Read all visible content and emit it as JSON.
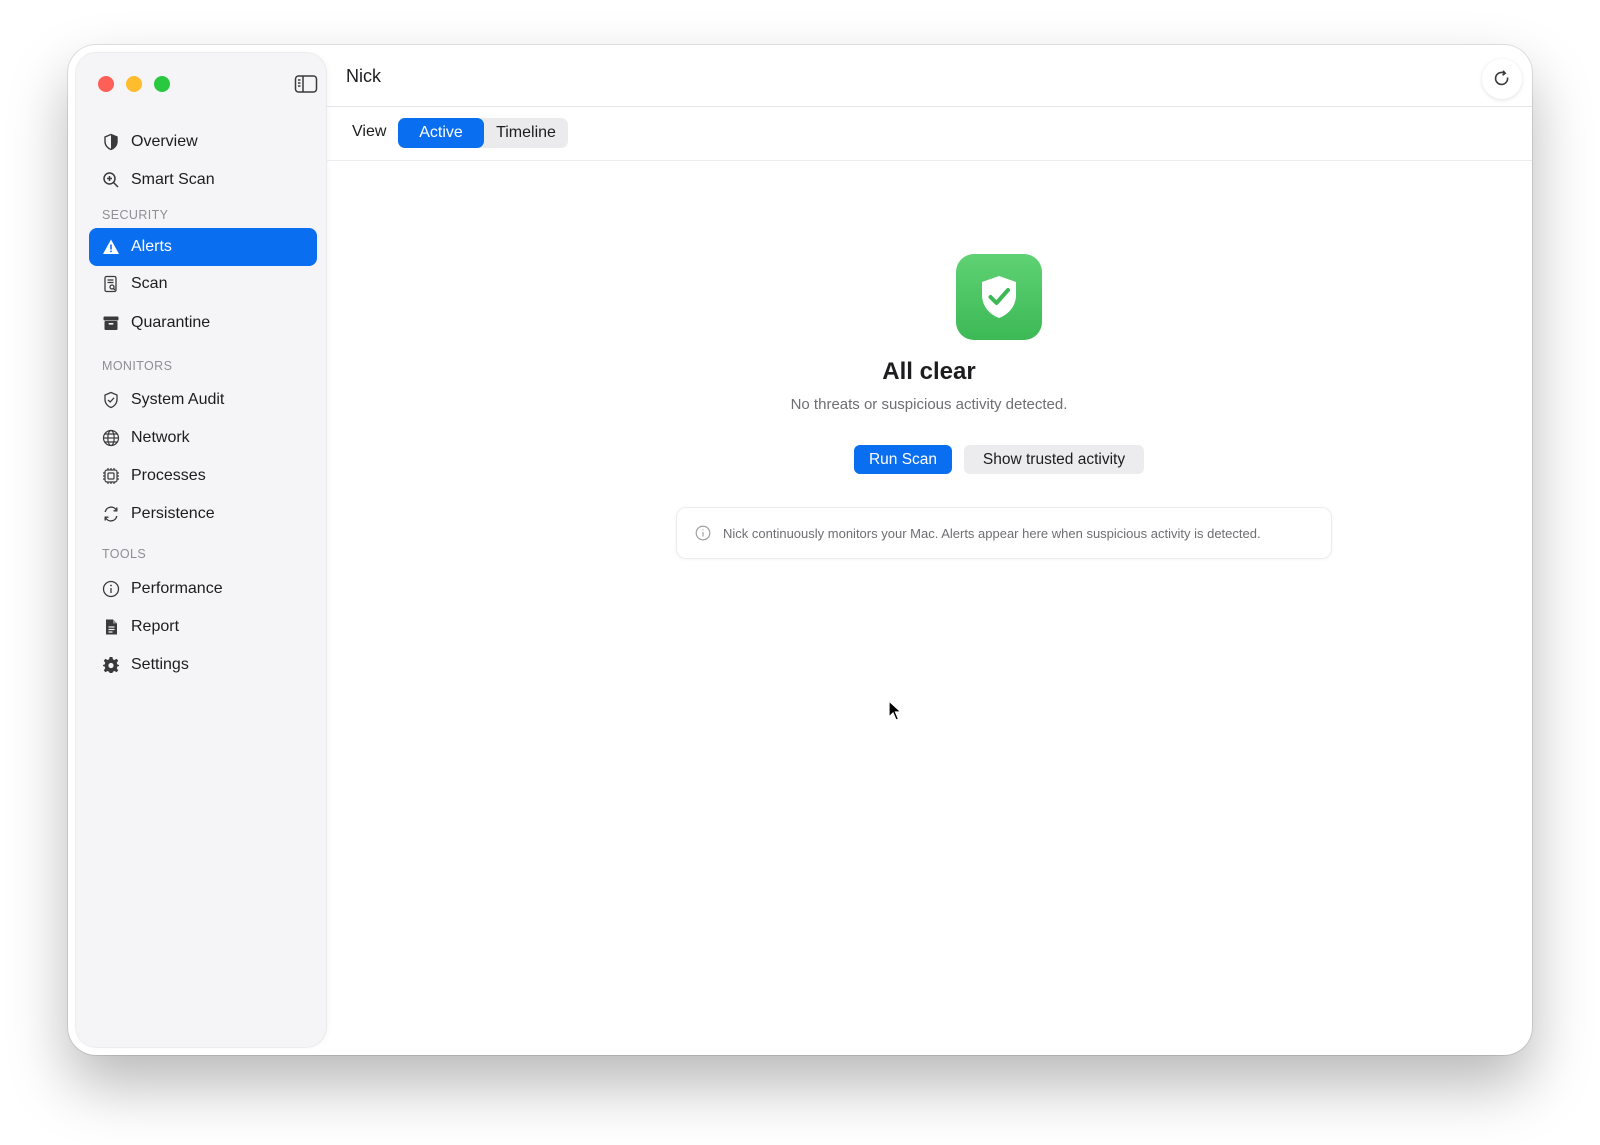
{
  "app": {
    "title": "Nick"
  },
  "sidebar": {
    "top_items": [
      {
        "label": "Overview",
        "icon": "shield-half-icon"
      },
      {
        "label": "Smart Scan",
        "icon": "magnifier-plus-icon"
      }
    ],
    "sections": [
      {
        "label": "SECURITY",
        "items": [
          {
            "label": "Alerts",
            "icon": "warning-triangle-icon",
            "active": true
          },
          {
            "label": "Scan",
            "icon": "document-search-icon"
          },
          {
            "label": "Quarantine",
            "icon": "archive-box-icon"
          }
        ]
      },
      {
        "label": "MONITORS",
        "items": [
          {
            "label": "System Audit",
            "icon": "checkmark-shield-icon"
          },
          {
            "label": "Network",
            "icon": "globe-icon"
          },
          {
            "label": "Processes",
            "icon": "cpu-icon"
          },
          {
            "label": "Persistence",
            "icon": "cycle-arrows-icon"
          }
        ]
      },
      {
        "label": "TOOLS",
        "items": [
          {
            "label": "Performance",
            "icon": "gauge-icon"
          },
          {
            "label": "Report",
            "icon": "document-icon"
          },
          {
            "label": "Settings",
            "icon": "gear-icon"
          }
        ]
      }
    ]
  },
  "toolbar": {
    "view_label": "View",
    "segments": [
      {
        "label": "Active",
        "selected": true
      },
      {
        "label": "Timeline",
        "selected": false
      }
    ]
  },
  "empty_state": {
    "icon": "shield-check-icon",
    "title": "All clear",
    "subtitle": "No threats or suspicious activity detected.",
    "primary_button": "Run Scan",
    "secondary_button": "Show trusted activity",
    "info_text": "Nick continuously monitors your Mac. Alerts appear here when suspicious activity is detected."
  },
  "colors": {
    "accent": "#0a6ef0",
    "success": "#3cb955",
    "traffic_close": "#fe5f57",
    "traffic_minimize": "#febc2e",
    "traffic_maximize": "#28c840"
  }
}
